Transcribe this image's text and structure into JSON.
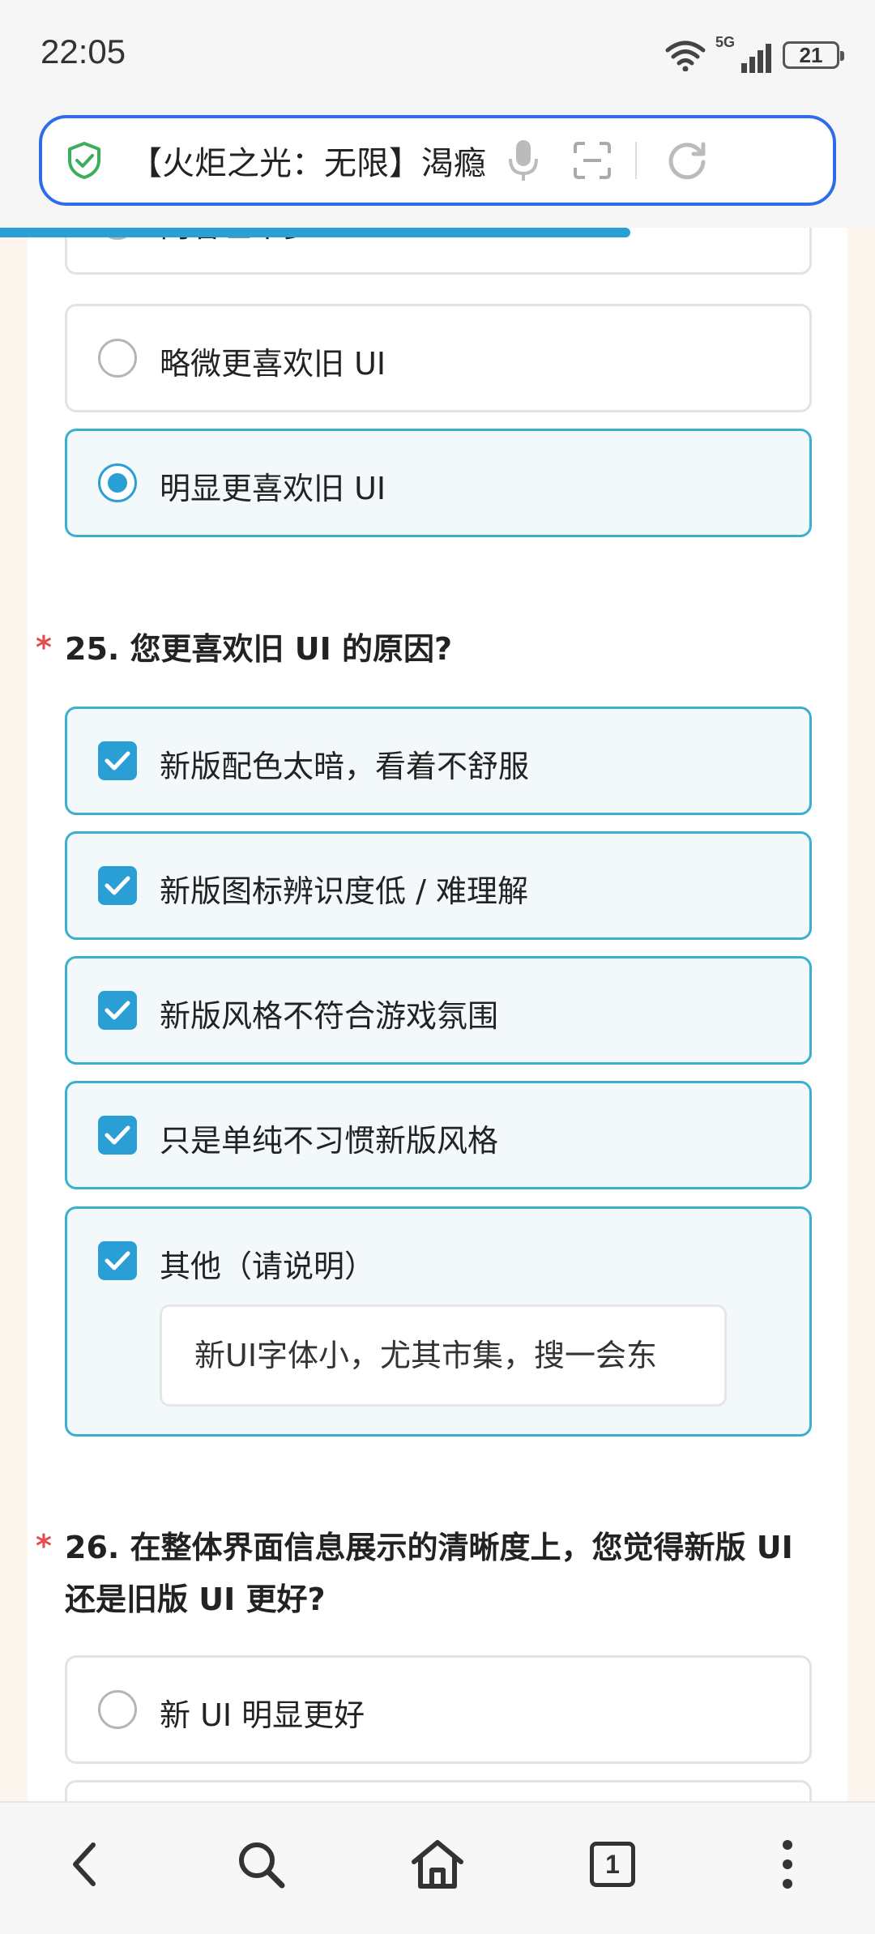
{
  "status": {
    "time": "22:05",
    "network": "5G",
    "battery": "21"
  },
  "browser": {
    "url_title": "【火炬之光：无限】渴瘾赛季",
    "progress_percent": 72,
    "tab_count": "1"
  },
  "survey": {
    "q24_options": [
      {
        "label": "两者差不多",
        "selected": false
      },
      {
        "label": "略微更喜欢旧 UI",
        "selected": false
      },
      {
        "label": "明显更喜欢旧 UI",
        "selected": true
      }
    ],
    "q25": {
      "required_mark": "*",
      "title": "25. 您更喜欢旧 UI 的原因?",
      "options": [
        {
          "label": "新版配色太暗，看着不舒服",
          "checked": true
        },
        {
          "label": "新版图标辨识度低 / 难理解",
          "checked": true
        },
        {
          "label": "新版风格不符合游戏氛围",
          "checked": true
        },
        {
          "label": "只是单纯不习惯新版风格",
          "checked": true
        },
        {
          "label": "其他（请说明）",
          "checked": true
        }
      ],
      "other_value": "新UI字体小，尤其市集，搜一会东"
    },
    "q26": {
      "required_mark": "*",
      "title": "26. 在整体界面信息展示的清晰度上，您觉得新版 UI 还是旧版 UI 更好?",
      "options": [
        {
          "label": "新 UI 明显更好",
          "selected": false
        }
      ]
    }
  },
  "colors": {
    "accent": "#2a9fd6",
    "selected_border": "#3ab0cc",
    "address_border": "#2f6ce8",
    "required": "#e34d4d"
  },
  "icons": {
    "address": [
      "shield-check-icon",
      "microphone-icon",
      "scan-icon",
      "reload-icon"
    ],
    "nav": [
      "back-icon",
      "search-icon",
      "home-icon",
      "tabs-icon",
      "more-icon"
    ]
  }
}
